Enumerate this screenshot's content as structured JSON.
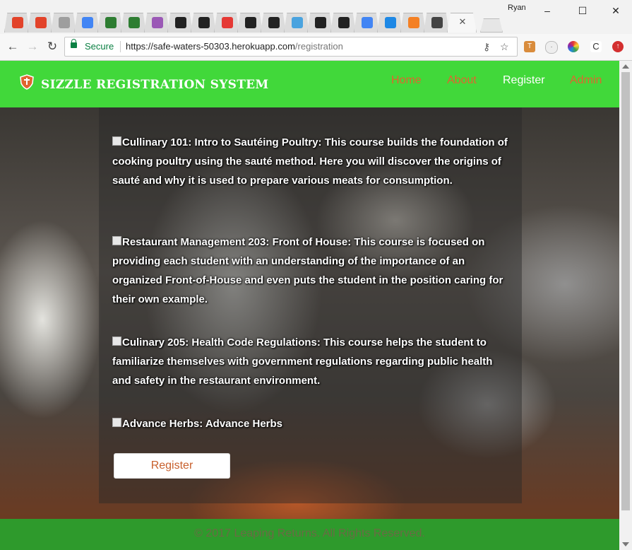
{
  "browser": {
    "profile_name": "Ryan",
    "tabs": [
      {
        "icon": "gitlab-icon",
        "color": "#e2432a"
      },
      {
        "icon": "gitlab-icon",
        "color": "#e2432a"
      },
      {
        "icon": "page-icon",
        "color": "#9e9e9e"
      },
      {
        "icon": "docs-icon",
        "color": "#4285f4"
      },
      {
        "icon": "code-icon",
        "color": "#2e7d32"
      },
      {
        "icon": "code-icon",
        "color": "#2e7d32"
      },
      {
        "icon": "k-icon",
        "color": "#9b59b6"
      },
      {
        "icon": "github-icon",
        "color": "#222222"
      },
      {
        "icon": "github-icon",
        "color": "#222222"
      },
      {
        "icon": "youtube-icon",
        "color": "#e53935"
      },
      {
        "icon": "github-icon",
        "color": "#222222"
      },
      {
        "icon": "github-icon",
        "color": "#222222"
      },
      {
        "icon": "p-icon",
        "color": "#4aa3df"
      },
      {
        "icon": "github-icon",
        "color": "#222222"
      },
      {
        "icon": "github-icon",
        "color": "#222222"
      },
      {
        "icon": "google-icon",
        "color": "#4285f4"
      },
      {
        "icon": "wave-icon",
        "color": "#1e88e5"
      },
      {
        "icon": "stack-icon",
        "color": "#f48024"
      },
      {
        "icon": "codepen-icon",
        "color": "#444444"
      }
    ],
    "active_tab_close": "✕",
    "address": {
      "secure_label": "Secure",
      "url_host": "https://safe-waters-50303.herokuapp.com",
      "url_path": "/registration"
    }
  },
  "site": {
    "brand": "SIZZLE REGISTRATION SYSTEM",
    "nav": {
      "home": "Home",
      "about": "About",
      "register": "Register",
      "admin": "Admin"
    },
    "accent_color": "#41d83a",
    "link_color": "#e0652f"
  },
  "courses": [
    {
      "text": "Cullinary 101: Intro to Sautéing Poultry: This course builds the foundation of cooking poultry using the sauté method. Here you will discover the origins of sauté and why it is used to prepare various meats for consumption.",
      "checked": false
    },
    {
      "text": "Restaurant Management 203: Front of House: This course is focused on providing each student with an understanding of the importance of an organized Front-of-House and even puts the student in the position caring for their own example.",
      "checked": false
    },
    {
      "text": "Culinary 205: Health Code Regulations: This course helps the student to familiarize themselves with government regulations regarding public health and safety in the restaurant environment.",
      "checked": false
    },
    {
      "text": "Advance Herbs: Advance Herbs",
      "checked": false
    }
  ],
  "register_button": "Register",
  "footer": "© 2017 Leaping Returns. All Rights Reserved."
}
